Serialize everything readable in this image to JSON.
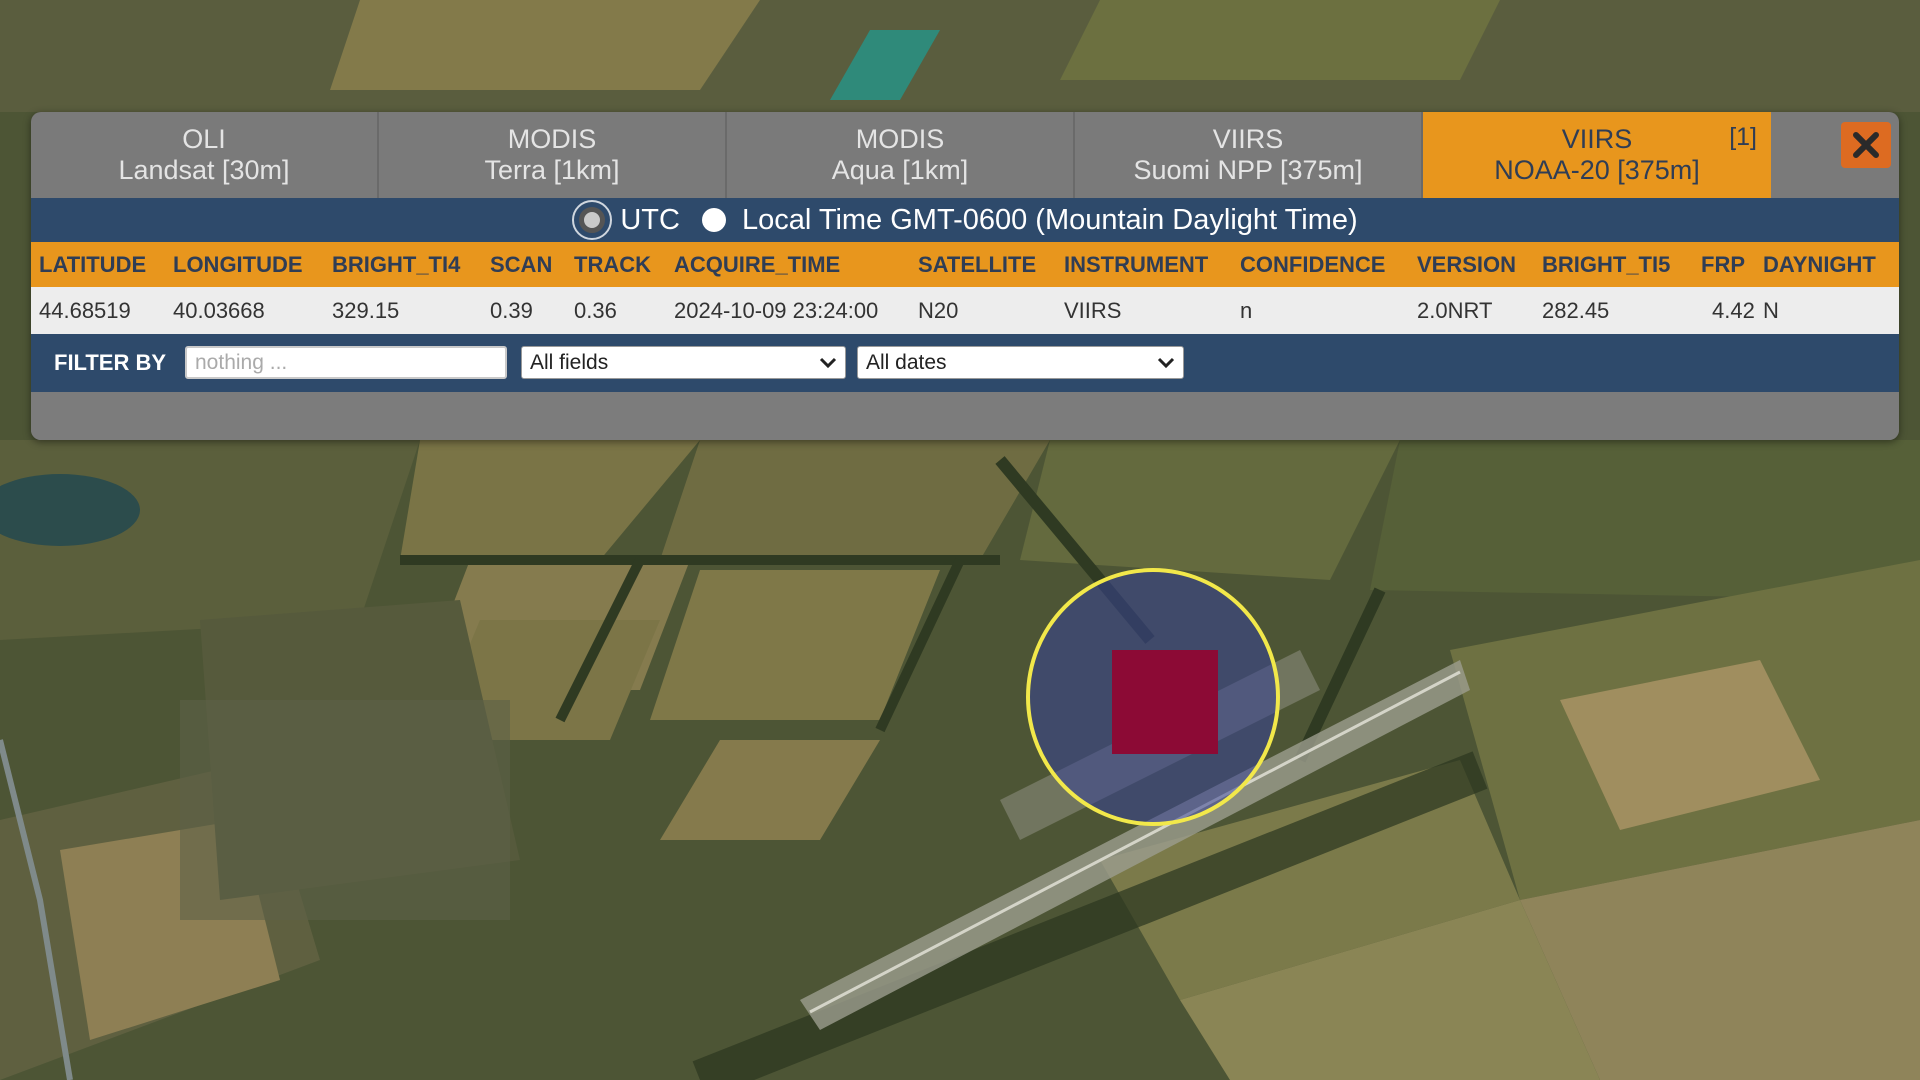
{
  "tabs": [
    {
      "line1": "OLI",
      "line2": "Landsat [30m]",
      "active": false
    },
    {
      "line1": "MODIS",
      "line2": "Terra [1km]",
      "active": false
    },
    {
      "line1": "MODIS",
      "line2": "Aqua [1km]",
      "active": false
    },
    {
      "line1": "VIIRS",
      "line2": "Suomi NPP [375m]",
      "active": false
    },
    {
      "line1": "VIIRS",
      "line2": "NOAA-20 [375m]",
      "active": true,
      "count": "[1]"
    }
  ],
  "time_mode": {
    "utc_label": "UTC",
    "local_label": "Local Time GMT-0600 (Mountain Daylight Time)",
    "selected": "utc"
  },
  "table": {
    "headers": [
      "LATITUDE",
      "LONGITUDE",
      "BRIGHT_TI4",
      "SCAN",
      "TRACK",
      "ACQUIRE_TIME",
      "SATELLITE",
      "INSTRUMENT",
      "CONFIDENCE",
      "VERSION",
      "BRIGHT_TI5",
      "FRP",
      "DAYNIGHT"
    ],
    "rows": [
      [
        "44.68519",
        "40.03668",
        "329.15",
        "0.39",
        "0.36",
        "2024-10-09 23:24:00",
        "N20",
        "VIIRS",
        "n",
        "2.0NRT",
        "282.45",
        "4.42",
        "N"
      ]
    ]
  },
  "filter": {
    "label": "FILTER BY",
    "placeholder": "nothing ...",
    "field_select": "All fields",
    "date_select": "All dates"
  },
  "colors": {
    "accent_orange": "#e8961d",
    "bar_blue": "#2e4a6b",
    "close_orange": "#dd6b21",
    "fire_pixel": "#8c0a35",
    "marker_ring": "#f2e84a"
  }
}
